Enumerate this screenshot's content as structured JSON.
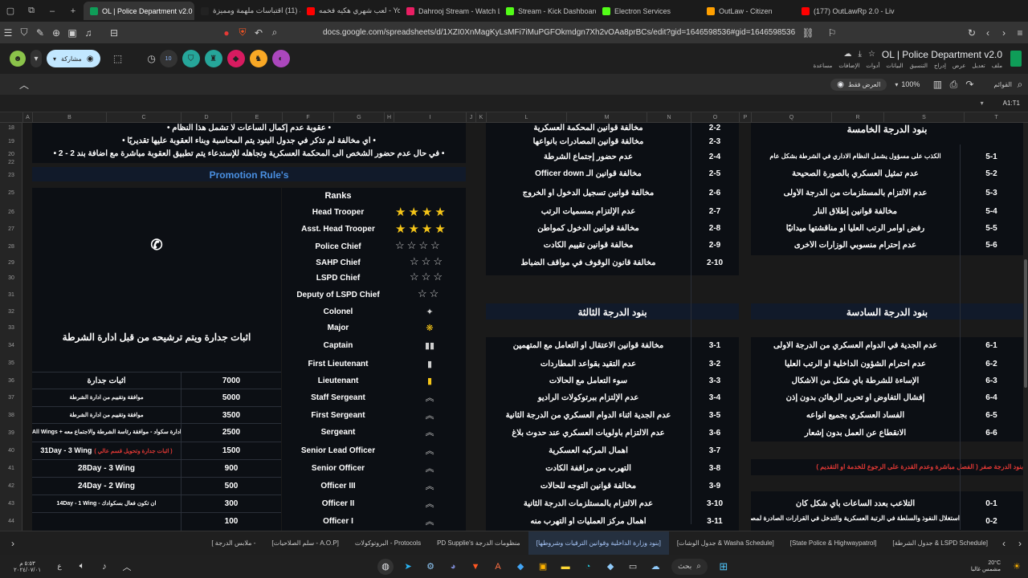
{
  "browser": {
    "tabs": [
      {
        "label": "OL | Police Department v2.0",
        "active": true,
        "color": "#0f9d58"
      },
      {
        "label": "لعبة (11) اقتباسات ملهمة ومميزة | To",
        "color": "#222"
      },
      {
        "label": "لعب شهري هكيه فخمه - YouTube",
        "color": "#ff0000"
      },
      {
        "label": "Dahrooj Stream - Watch Live o",
        "color": "#e91e63"
      },
      {
        "label": "Stream - Kick Dashboard",
        "color": "#53fc18"
      },
      {
        "label": "Electron Services",
        "color": "#53fc18"
      },
      {
        "label": "OutLaw - Citizen",
        "color": "#ffa000"
      },
      {
        "label": "(177) OutLawRp 2.0 - Live Com",
        "color": "#ff0000"
      }
    ],
    "new_tab": "+",
    "url": "docs.google.com/spreadsheets/d/1XZI0XnMagKyLsMFi7iMuPGFOkmdgn7Xh2vOAa8prBCs/edit?gid=1646598536#gid=1646598536",
    "ext_badge": "10"
  },
  "sheets": {
    "title": "OL | Police Department v2.0",
    "menu": [
      "ملف",
      "تعديل",
      "عرض",
      "إدراج",
      "التنسيق",
      "البيانات",
      "أدوات",
      "الإضافات",
      "مساعدة"
    ],
    "share_label": "مشاركة",
    "mode_label": "العرض فقط",
    "zoom": "100%",
    "menus_label": "القوائم",
    "cell_ref": "A1:T1"
  },
  "columns": [
    "A",
    "B",
    "C",
    "D",
    "E",
    "F",
    "G",
    "H",
    "I",
    "J",
    "K",
    "L",
    "M",
    "N",
    "O",
    "P",
    "Q",
    "R",
    "S",
    "T"
  ],
  "rows": [
    "18",
    "19",
    "20",
    "22",
    "23",
    "25",
    "26",
    "27",
    "28",
    "29",
    "30",
    "31",
    "32",
    "33",
    "34",
    "35",
    "36",
    "37",
    "38",
    "39",
    "40",
    "41",
    "42",
    "43",
    "44"
  ],
  "rules_top": [
    "• عقوبة عدم إكمال الساعات لا تشمل هذا النظام •",
    "• أي مخالفة لم تذكر في جدول البنود يتم المحاسبة وبناء العقوبة عليها تقديريًا •",
    "• في حال عدم حضور الشخص الى المحكمة العسكرية وتجاهله للإستدعاء يتم تطبيق العقوبة مباشرة مع اضافة بند 2 - 2 •"
  ],
  "promotion_title": "Promotion Rule's",
  "merit_text": "اثبات جدارة ويتم ترشيحه من قبل ادارة الشرطة",
  "ranks_header": "Ranks",
  "ranks": [
    {
      "name": "Head Trooper",
      "stars": 4,
      "kind": "gold"
    },
    {
      "name": "Asst. Head Trooper",
      "stars": 4,
      "kind": "gold"
    },
    {
      "name": "Police Chief",
      "stars": 4,
      "kind": "white"
    },
    {
      "name": "SAHP Chief",
      "stars": 3,
      "kind": "white"
    },
    {
      "name": "LSPD Chief",
      "stars": 3,
      "kind": "white"
    },
    {
      "name": "Deputy of LSPD Chief",
      "stars": 2,
      "kind": "white"
    },
    {
      "name": "Colonel",
      "icon": "eagle-icon"
    },
    {
      "name": "Major",
      "icon": "oak-leaf-icon"
    },
    {
      "name": "Captain",
      "icon": "double-bar-icon"
    },
    {
      "name": "First Lieutenant",
      "icon": "silver-bar-icon"
    },
    {
      "name": "Lieutenant",
      "points": "7000",
      "req": "اثبات جدارة",
      "icon": "gold-bar-icon"
    },
    {
      "name": "Staff Sergeant",
      "points": "5000",
      "req": "موافقة وتقييم من ادارة الشرطة",
      "icon": "chevron-icon"
    },
    {
      "name": "First Sergeant",
      "points": "3500",
      "req": "موافقة وتقييم من ادارة الشرطة",
      "icon": "chevron-icon"
    },
    {
      "name": "Sergeant",
      "points": "2500",
      "req": "All Wings + ادارة سكواد - موافقة رئاسة الشرطة والاجتماع معه",
      "icon": "chevron-icon"
    },
    {
      "name": "Senior Lead Officer",
      "points": "1500",
      "req": "31Day - 3 Wing",
      "req_red": "( اثبات جدارة وتحويل قسم عالي )",
      "icon": "chevron-icon"
    },
    {
      "name": "Senior Officer",
      "points": "900",
      "req": "28Day - 3 Wing",
      "icon": "chevron-icon"
    },
    {
      "name": "Officer III",
      "points": "500",
      "req": "24Day - 2 Wing",
      "icon": "chevron-icon"
    },
    {
      "name": "Officer II",
      "points": "300",
      "req": "14Day - 1 Wing - ان تكون فعال بسكوادك",
      "icon": "chevron-icon"
    },
    {
      "name": "Officer I",
      "points": "100",
      "req": "",
      "icon": "chevron-icon"
    }
  ],
  "middle_top": [
    {
      "code": "2-2",
      "text": "مخالفة قوانين المحكمة العسكرية"
    },
    {
      "code": "2-3",
      "text": "مخالفة قوانين المصادرات بأنواعها"
    },
    {
      "code": "2-4",
      "text": "عدم حضور إجتماع الشرطة"
    },
    {
      "code": "2-5",
      "text": "مخالفة قوانين الـ Officer down"
    },
    {
      "code": "2-6",
      "text": "مخالفة قوانين تسجيل الدخول أو الخروج"
    },
    {
      "code": "2-7",
      "text": "عدم الإلتزام بمسميات الرتب"
    },
    {
      "code": "2-8",
      "text": "مخالفة قوانين الدخول كمواطن"
    },
    {
      "code": "2-9",
      "text": "مخالفة قوانين تقييم الكادت"
    },
    {
      "code": "2-10",
      "text": "مخالفة قانون الوقوف في مواقف الضباط"
    }
  ],
  "middle_header": "بنود الدرجة الثالثة",
  "middle_bottom": [
    {
      "code": "3-1",
      "text": "مخالفة قوانين الاعتقال او التعامل مع المتهمين"
    },
    {
      "code": "3-2",
      "text": "عدم التقيد بقواعد المطاردات"
    },
    {
      "code": "3-3",
      "text": "سوء التعامل مع الحالات"
    },
    {
      "code": "3-4",
      "text": "عدم الإلتزام ببرتوكولات الراديو"
    },
    {
      "code": "3-5",
      "text": "عدم الجدية اثناء الدوام العسكري من الدرجة الثانية"
    },
    {
      "code": "3-6",
      "text": "عدم الالتزام بأولويات العسكري عند حدوث بلاغ"
    },
    {
      "code": "3-7",
      "text": "اهمال المركبه العسكرية"
    },
    {
      "code": "3-8",
      "text": "التهرب من مراقفة الكادت"
    },
    {
      "code": "3-9",
      "text": "مخالفة قوانين التوجه للحالات"
    },
    {
      "code": "3-10",
      "text": "عدم الالتزام بالمستلزمات الدرجة الثانية"
    },
    {
      "code": "3-11",
      "text": "اهمال مركز العمليات أو التهرب منه"
    }
  ],
  "right_header5": "بنود الدرجة الخامسة",
  "right_top": [
    {
      "code": "5-1",
      "text": "الكذب على مسؤول يشمل النظام الاداري في الشرطة بشكل عام"
    },
    {
      "code": "5-2",
      "text": "عدم تمثيل العسكري بالصورة الصحيحة"
    },
    {
      "code": "5-3",
      "text": "عدم الالتزام بالمستلزمات من الدرجة الأولى"
    },
    {
      "code": "5-4",
      "text": "مخالفة قوانين إطلاق النار"
    },
    {
      "code": "5-5",
      "text": "رفض اوامر الرتب العليا أو مناقشتها ميدانيًا"
    },
    {
      "code": "5-6",
      "text": "عدم إحترام منسوبي الوزارات الأخرى"
    }
  ],
  "right_header6": "بنود الدرجة السادسة",
  "right_bottom": [
    {
      "code": "6-1",
      "text": "عدم الجدية في الدوام العسكري من الدرجة الاولى"
    },
    {
      "code": "6-2",
      "text": "عدم احترام الشؤون الداخلية أو الرتب العليا"
    },
    {
      "code": "6-3",
      "text": "الإساءة للشرطة بأي شكل من الأشكال"
    },
    {
      "code": "6-4",
      "text": "إفشال التفاوض او تحرير الرهائن بدون إذن"
    },
    {
      "code": "6-5",
      "text": "الفساد العسكري بجميع أنواعه"
    },
    {
      "code": "6-6",
      "text": "الانقطاع عن العمل بدون إشعار"
    }
  ],
  "zero_header": "بنود الدرجة صفر ( الفصل مباشرة وعدم القدرة على الرجوع للخدمة او التقديم )",
  "zero_rows": [
    {
      "code": "0-1",
      "text": "التلاعب بعدد الساعات بأي شكل كان"
    },
    {
      "code": "0-2",
      "text": "استغلال النفوذ والسلطة في الرتبة العسكرية والتدخل في القرارات الصادرة لمصالح شخصية"
    }
  ],
  "sheet_tabs": [
    "[جدول الشرطة & LSPD Schedule]",
    "[State Police & Highwaypatrol]",
    "[جدول الوشات & Washa Schedule]",
    "[بنود وزارة الداخلية وقوانين الترقيات وشروطها]",
    "PD Supplie's منظومات الدرجة",
    "البروتوكولات - Protocols",
    "[سلم الصلاحيات - A.O.P]",
    "[ ملابس الدرجة -"
  ],
  "taskbar": {
    "weather_temp": "20°C",
    "weather_desc": "مشمس غالبا",
    "time": "٥:٥٣ م",
    "date": "٢٠٢٤/٠٧/٠١",
    "search": "بحث"
  }
}
